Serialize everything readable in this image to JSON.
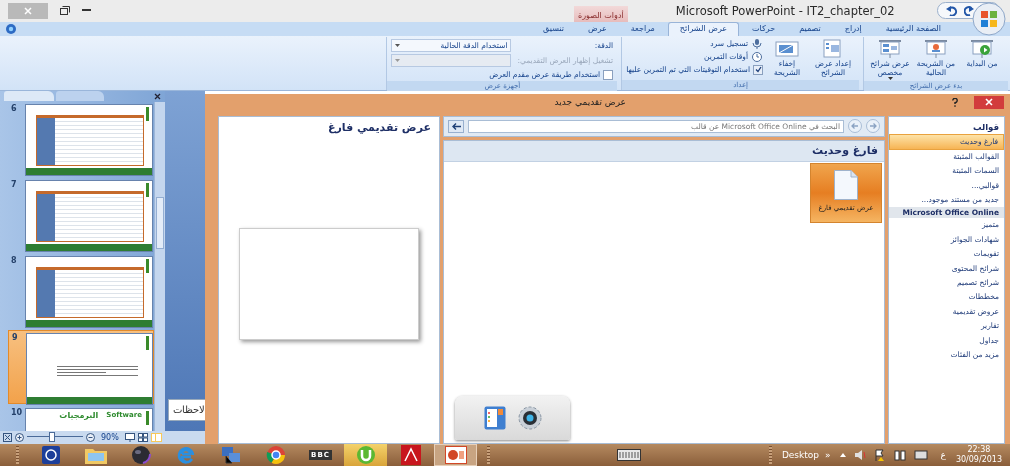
{
  "window": {
    "title": "Microsoft PowerPoint - IT2_chapter_02",
    "context_tab_label": "أدوات الصورة"
  },
  "ribbon_tabs": [
    {
      "label": "الصفحة الرئيسية",
      "selected": false
    },
    {
      "label": "إدراج",
      "selected": false
    },
    {
      "label": "تصميم",
      "selected": false
    },
    {
      "label": "حركات",
      "selected": false
    },
    {
      "label": "عرض الشرائح",
      "selected": true
    },
    {
      "label": "مراجعة",
      "selected": false
    },
    {
      "label": "عرض",
      "selected": false
    },
    {
      "label": "تنسيق",
      "selected": false
    }
  ],
  "start_group": {
    "title": "بدء عرض الشرائح",
    "buttons": [
      {
        "label": "من البداية",
        "kind": "play"
      },
      {
        "label": "من الشريحة الحالية",
        "kind": "screen"
      },
      {
        "label": "عرض شرائح مخصص",
        "kind": "custom"
      }
    ]
  },
  "setup_group": {
    "title": "إعداد",
    "buttons": [
      {
        "label": "إعداد عرض الشرائح",
        "kind": "setup"
      },
      {
        "label": "إخفاء الشريحة",
        "kind": "hide"
      }
    ],
    "small_buttons": [
      {
        "label": "تسجيل سرد",
        "kind": "record"
      },
      {
        "label": "أوقات التمرين",
        "kind": "timings"
      }
    ],
    "timings_checkbox": {
      "label": "استخدام التوقيتات التي تم التمرين عليها",
      "checked": true
    }
  },
  "monitors_group": {
    "title": "أجهزة عرض",
    "resolution_label": "الدقة:",
    "resolution_value": "استخدام الدقة الحالية",
    "show_on_label": "تشغيل إظهار العرض التقديمي:",
    "show_on_disabled": true,
    "presenter_checkbox": {
      "label": "استخدام طريقة عرض مقدم العرض",
      "checked": false
    }
  },
  "slides_panel": {
    "slides": [
      {
        "number": "6",
        "selected": false,
        "kind": "screenshot"
      },
      {
        "number": "7",
        "selected": false,
        "kind": "screenshot"
      },
      {
        "number": "8",
        "selected": false,
        "kind": "screenshot"
      },
      {
        "number": "9",
        "selected": true,
        "kind": "text"
      },
      {
        "number": "10",
        "selected": false,
        "kind": "title",
        "title": "البرمجيات",
        "subtitle": "Software"
      }
    ]
  },
  "notes_label": "لاحظات",
  "status_bar": {
    "zoom": "90%",
    "zoom_slider": {
      "level": 0.45
    }
  },
  "dialog": {
    "title": "عرض تقديمي جديد",
    "preview_title": "عرض تقديمي فارغ",
    "search": {
      "placeholder": "البحث في Microsoft Office Online عن قالب"
    },
    "section_title": "فارغ وحديث",
    "templates": [
      {
        "label": "عرض تقديمي فارغ",
        "selected": true
      }
    ],
    "sidebar": {
      "heading": "قوالب",
      "items": [
        {
          "label": "فارغ وحديث",
          "selected": true
        },
        {
          "label": "القوالب المثبتة",
          "selected": false
        },
        {
          "label": "السمات المثبتة",
          "selected": false
        },
        {
          "label": "قوالبي...",
          "selected": false
        },
        {
          "label": "جديد من مستند موجود...",
          "selected": false
        }
      ],
      "online_heading": "Microsoft Office Online",
      "online_items": [
        {
          "label": "متميز",
          "selected": false
        },
        {
          "label": "شهادات الجوائز",
          "selected": false
        },
        {
          "label": "تقويمات",
          "selected": false
        },
        {
          "label": "شرائح المحتوى",
          "selected": false
        },
        {
          "label": "شرائح تصميم",
          "selected": false
        },
        {
          "label": "مخططات",
          "selected": false
        },
        {
          "label": "عروض تقديمية",
          "selected": false
        },
        {
          "label": "تقارير",
          "selected": false
        },
        {
          "label": "جداول",
          "selected": false
        },
        {
          "label": "مزيد من الفئات",
          "selected": false
        }
      ]
    }
  },
  "taskbar": {
    "bbc_label": "BBC",
    "desktop_label": "Desktop",
    "chevron": "»",
    "language": "ع",
    "time": "22:38",
    "date": "30/09/2013"
  }
}
